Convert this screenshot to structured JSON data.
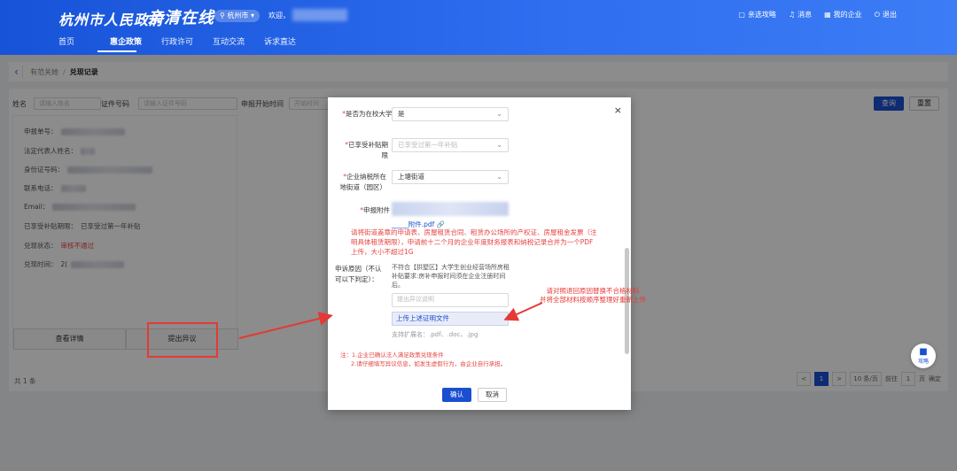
{
  "header": {
    "logo": "杭州市人民政府",
    "slogan": "亲清在线",
    "city": "杭州市",
    "welcome": "欢迎",
    "links": [
      {
        "icon": "guide-icon",
        "glyph": "▢",
        "label": "亲选攻略"
      },
      {
        "icon": "bell-icon",
        "glyph": "♫",
        "label": "消息"
      },
      {
        "icon": "building-icon",
        "glyph": "▦",
        "label": "我的企业"
      },
      {
        "icon": "power-icon",
        "glyph": "⏻",
        "label": "退出"
      }
    ],
    "nav": [
      "首页",
      "惠企政策",
      "行政许可",
      "互动交流",
      "诉求直达"
    ]
  },
  "breadcrumb": {
    "parent": "有范关她",
    "current": "兑现记录"
  },
  "filters": {
    "name_label": "姓名",
    "name_placeholder": "请输入姓名",
    "id_label": "证件号码",
    "id_placeholder": "请输入证件号码",
    "date_label": "申报开始时间",
    "date_placeholder": "开始时间",
    "query_label": "查询",
    "reset_label": "重置"
  },
  "record": {
    "fields": [
      {
        "label": "申报单号：",
        "value": ""
      },
      {
        "label": "法定代表人姓名：",
        "value": ""
      },
      {
        "label": "身份证号码：",
        "value": ""
      },
      {
        "label": "联系电话：",
        "value": ""
      },
      {
        "label": "Email：",
        "value": ""
      },
      {
        "label": "已享受补贴期限：",
        "value": "已享受过第一年补贴"
      },
      {
        "label": "兑现状态：",
        "value": "审核不通过"
      },
      {
        "label": "兑现时间：",
        "value": "2("
      }
    ],
    "detail_label": "查看详情",
    "objection_label": "提出异议"
  },
  "pagination": {
    "total": "共 1 条",
    "prev": "<",
    "current": "1",
    "next": ">",
    "page_size": "10 条/页",
    "goto_label": "前往",
    "goto_value": "1",
    "page_unit": "页",
    "confirm": "确定"
  },
  "float_button": {
    "label": "攻略"
  },
  "dialog": {
    "close": "×",
    "is_student_label": "是否为在校大学生",
    "is_student_value": "是",
    "subsidy_period_label": "已享受补贴期限",
    "subsidy_period_value": "已享受过第一年补贴",
    "street_label": "企业纳税所在地街道（园区）",
    "street_value": "上塘街道",
    "attachment_label": "申报附件",
    "attachment_file": "_____附件.pdf",
    "attachment_note": "请将街道盖章的申请表、房屋租赁合同、租赁办公场所的产权证、房屋租金发票（注明具体租赁期限），申请前十二个月的企业年度财务报表和纳税记录合并为一个PDF上传，大小不超过1G",
    "reason_label": "申诉原因（不认可以下判定）：",
    "reason_text": "不符合【拱墅区】大学生创业经营场所房租补贴要求:房补申报时间须在企业注册时间后。",
    "reason_placeholder": "提出异议说明",
    "upload_label": "上传上述证明文件",
    "upload_hint": "支持扩展名：.pdf、.doc、.jpg",
    "note_1": "注：1.企业已确认法人满足政策兑现条件",
    "note_2": "2.请仔细填写异议信息，如发生虚假行为，由企业自行承担。",
    "confirm_label": "确认",
    "cancel_label": "取消"
  },
  "annotation": {
    "callout": "请对照退回原因替换不合格材料\n并将全部材料按顺序整理好重新上传"
  },
  "colors": {
    "primary": "#1b4fd1",
    "header": "#2f6ff0",
    "error": "#e64340",
    "annotation": "#e53935"
  }
}
